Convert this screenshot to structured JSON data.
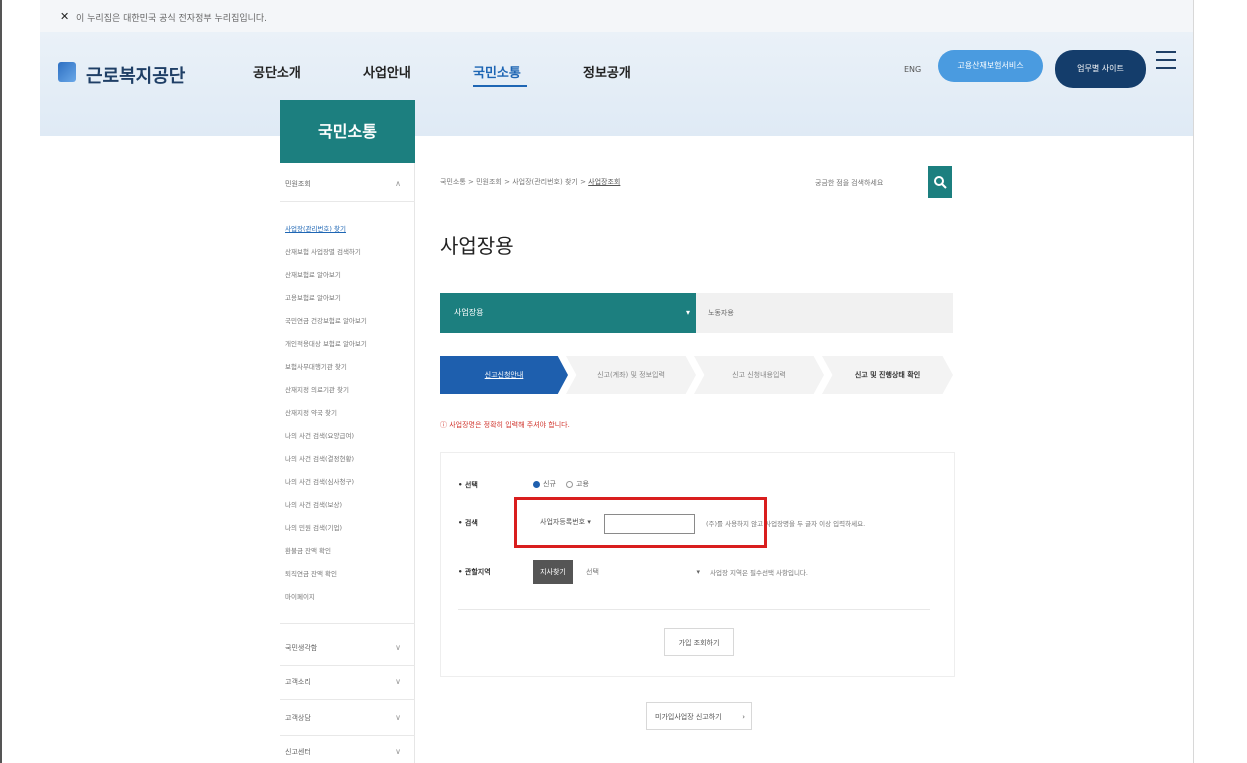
{
  "gov_banner": {
    "close_glyph": "✕",
    "text": "이 누리집은 대한민국 공식 전자정부 누리집입니다."
  },
  "header": {
    "logo_text": "근로복지공단",
    "nav": [
      "공단소개",
      "사업안내",
      "국민소통",
      "정보공개"
    ],
    "active_nav": "국민소통",
    "eng_label": "ENG",
    "info_button": "고용산재보험서비스",
    "work_button": "업무별 사이트",
    "accent_color": "#1c7f7f",
    "nav_active_color": "#1e66b4"
  },
  "sidebar": {
    "title": "국민소통",
    "sections": [
      {
        "label": "민원조회",
        "open": true
      },
      {
        "label": "국민생각함"
      },
      {
        "label": "고객소리"
      },
      {
        "label": "고객상담"
      },
      {
        "label": "신고센터"
      }
    ],
    "items": [
      "사업장(관리번호) 찾기",
      "산재보험 사업장별 검색하기",
      "산재보험료 알아보기",
      "고용보험료 알아보기",
      "국민연금 건강보험료 알아보기",
      "개인적용대상 보험료 알아보기",
      "보험사무대행기관 찾기",
      "산재지정 의료기관 찾기",
      "산재지정 약국 찾기",
      "나의 사건 검색(요양급여)",
      "나의 사건 검색(결정현황)",
      "나의 사건 검색(심사청구)",
      "나의 사건 검색(보상)",
      "나의 민원 검색(기업)",
      "환불금 잔액 확인",
      "퇴직연금 잔액 확인",
      "마이페이지"
    ],
    "active_item": "사업장(관리번호) 찾기"
  },
  "main": {
    "breadcrumb": [
      "국민소통",
      "민원조회",
      "사업장(관리번호) 찾기"
    ],
    "breadcrumb_last": "사업장조회",
    "search_placeholder": "궁금한 점을 검색하세요",
    "title": "사업장용",
    "tab_main": "사업장용",
    "tab_sub": "노동자용",
    "steps": [
      "신고신청안내",
      "신고(계좌) 및 정보입력",
      "신고 신청내용입력",
      "신고 및 진행상태 확인"
    ],
    "notice": "ⓘ 사업장명은 정확히 입력해 주셔야 합니다.",
    "form": {
      "choice_label": "선택",
      "choice_options": [
        "신규",
        "고용"
      ],
      "search_label": "검색",
      "search_type": "사업자등록번호",
      "search_value": "",
      "search_help": "(주)를 사용하지 않고 사업장명을 두 글자 이상 입력하세요.",
      "region_label": "관할지역",
      "region_button": "지사찾기",
      "region_select": "선택",
      "region_help": "사업장 지역은 필수선택 사항입니다.",
      "lookup_button": "가입 조회하기"
    },
    "report_button": "미가입사업장 신고하기",
    "highlight_color": "#d91e1e"
  }
}
